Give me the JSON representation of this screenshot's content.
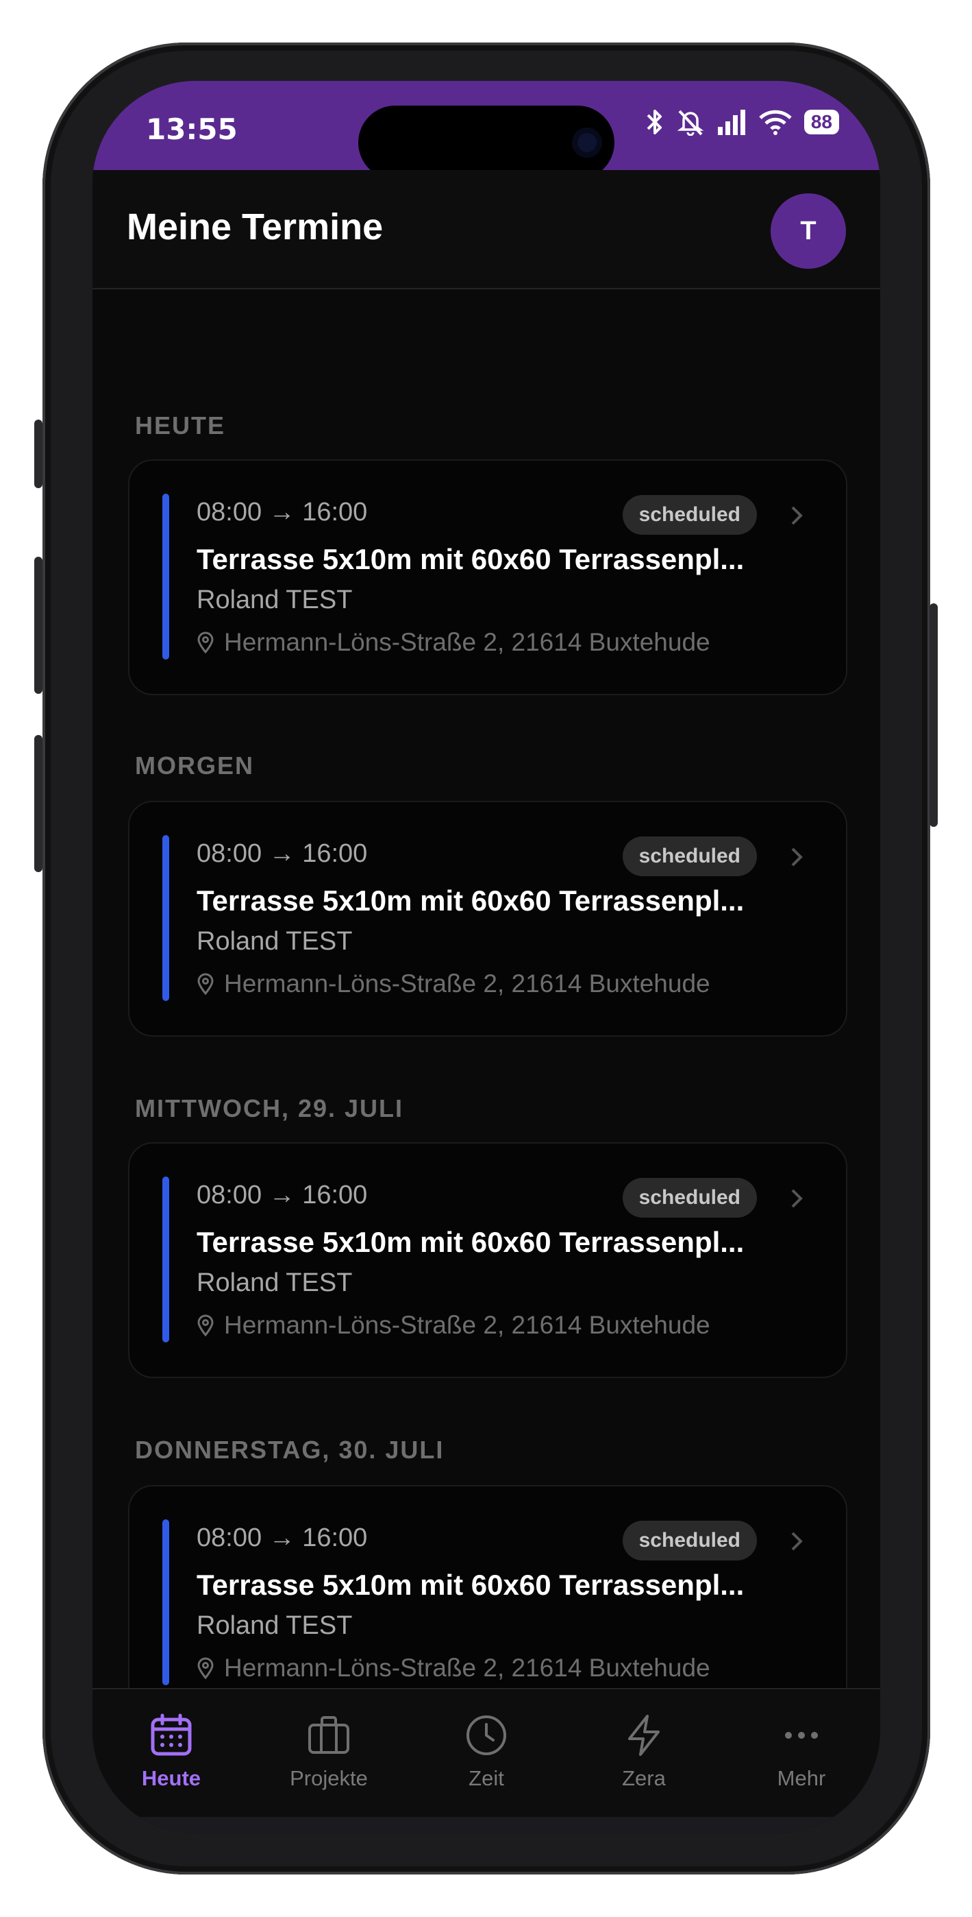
{
  "status_bar": {
    "time": "13:55",
    "battery": "88"
  },
  "header": {
    "title": "Meine Termine",
    "avatar_initial": "T"
  },
  "sections": [
    {
      "label": "HEUTE",
      "appointment": {
        "time": "08:00 → 16:00",
        "status": "scheduled",
        "title": "Terrasse 5x10m mit 60x60 Terrassenpl...",
        "customer": "Roland TEST",
        "address": "Hermann-Löns-Straße 2, 21614 Buxtehude"
      }
    },
    {
      "label": "MORGEN",
      "appointment": {
        "time": "08:00 → 16:00",
        "status": "scheduled",
        "title": "Terrasse 5x10m mit 60x60 Terrassenpl...",
        "customer": "Roland TEST",
        "address": "Hermann-Löns-Straße 2, 21614 Buxtehude"
      }
    },
    {
      "label": "MITTWOCH, 29. JULI",
      "appointment": {
        "time": "08:00 → 16:00",
        "status": "scheduled",
        "title": "Terrasse 5x10m mit 60x60 Terrassenpl...",
        "customer": "Roland TEST",
        "address": "Hermann-Löns-Straße 2, 21614 Buxtehude"
      }
    },
    {
      "label": "DONNERSTAG, 30. JULI",
      "appointment": {
        "time": "08:00 → 16:00",
        "status": "scheduled",
        "title": "Terrasse 5x10m mit 60x60 Terrassenpl...",
        "customer": "Roland TEST",
        "address": "Hermann-Löns-Straße 2, 21614 Buxtehude"
      }
    }
  ],
  "bottom_nav": [
    {
      "label": "Heute",
      "icon": "calendar-icon",
      "active": true
    },
    {
      "label": "Projekte",
      "icon": "briefcase-icon",
      "active": false
    },
    {
      "label": "Zeit",
      "icon": "clock-icon",
      "active": false
    },
    {
      "label": "Zera",
      "icon": "lightning-icon",
      "active": false
    },
    {
      "label": "Mehr",
      "icon": "more-icon",
      "active": false
    }
  ],
  "colors": {
    "accent": "#5b2a90",
    "active_nav": "#a370f7",
    "card_bar": "#2f5be8"
  }
}
